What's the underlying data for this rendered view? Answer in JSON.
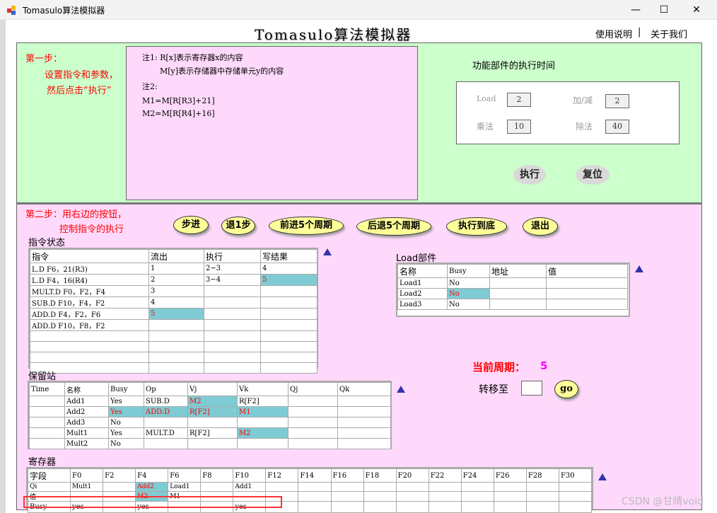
{
  "window": {
    "title": "Tomasulo算法模拟器",
    "controls": [
      "minimize",
      "maximize",
      "close"
    ]
  },
  "header": {
    "title": "Tomasulo算法模拟器",
    "links": [
      "使用说明",
      "关于我们"
    ],
    "separator": "|"
  },
  "step1": {
    "label": "第一步：",
    "line1": "设置指令和参数，",
    "line2": "然后点击“执行”"
  },
  "notes": {
    "n1": "注1: R[x]表示寄存器x的内容",
    "n1b": "M[y]表示存储器中存储单元y的内容",
    "n2": "注2:",
    "m1": "M1=M[R[R3]+21]",
    "m2": "M2=M[R[R4]+16]"
  },
  "exec_time": {
    "title": "功能部件的执行时间",
    "load_label": "Load",
    "load": "2",
    "add_label": "加/减",
    "add": "2",
    "mul_label": "乘法",
    "mul": "10",
    "div_label": "除法",
    "div": "40",
    "run": "执行",
    "reset": "复位"
  },
  "step2": {
    "line1": "第二步：用右边的按钮，",
    "line2": "控制指令的执行",
    "buttons": [
      "步进",
      "退1步",
      "前进5个周期",
      "后退5个周期",
      "执行到底",
      "退出"
    ]
  },
  "instr": {
    "title": "指令状态",
    "headers": [
      "指令",
      "流出",
      "执行",
      "写结果"
    ],
    "rows": [
      [
        "L.D    F6，21(R3)",
        "1",
        "2~3",
        "4"
      ],
      [
        "L.D    F4，16(R4)",
        "2",
        "3~4",
        "5"
      ],
      [
        "MULT.D F0，F2，F4",
        "3",
        "",
        ""
      ],
      [
        "SUB.D  F10，F4，F2",
        "4",
        "",
        ""
      ],
      [
        "ADD.D  F4，F2，F6",
        "5",
        "",
        ""
      ],
      [
        "ADD.D  F10，F8，F2",
        "",
        "",
        ""
      ]
    ]
  },
  "load": {
    "title": "Load部件",
    "headers": [
      "名称",
      "Busy",
      "地址",
      "值"
    ],
    "rows": [
      [
        "Load1",
        "No",
        "",
        ""
      ],
      [
        "Load2",
        "No",
        "",
        ""
      ],
      [
        "Load3",
        "No",
        "",
        ""
      ]
    ]
  },
  "cycle": {
    "label": "当前周期：",
    "value": "5",
    "goto_label": "转移至",
    "goto_value": "",
    "go": "go"
  },
  "rs": {
    "title": "保留站",
    "headers": [
      "Time",
      "名称",
      "Busy",
      "Op",
      "Vj",
      "Vk",
      "Qj",
      "Qk"
    ],
    "rows": [
      [
        "",
        "Add1",
        "Yes",
        "SUB.D",
        "M2",
        "R[F2]",
        "",
        ""
      ],
      [
        "",
        "Add2",
        "Yes",
        "ADD.D",
        "R[F2]",
        "M1",
        "",
        ""
      ],
      [
        "",
        "Add3",
        "No",
        "",
        "",
        "",
        "",
        ""
      ],
      [
        "",
        "Mult1",
        "Yes",
        "MULT.D",
        "R[F2]",
        "M2",
        "",
        ""
      ],
      [
        "",
        "Mult2",
        "No",
        "",
        "",
        "",
        "",
        ""
      ]
    ]
  },
  "reg": {
    "title": "寄存器",
    "headers": [
      "字段",
      "F0",
      "F2",
      "F4",
      "F6",
      "F8",
      "F10",
      "F12",
      "F14",
      "F16",
      "F18",
      "F20",
      "F22",
      "F24",
      "F26",
      "F28",
      "F30"
    ],
    "rows": [
      [
        "Qi",
        "Mult1",
        "",
        "Add2",
        "Load1",
        "",
        "Add1",
        "",
        "",
        "",
        "",
        "",
        "",
        "",
        "",
        "",
        ""
      ],
      [
        "值",
        "",
        "",
        "M2",
        "M1",
        "",
        "",
        "",
        "",
        "",
        "",
        "",
        "",
        "",
        "",
        "",
        ""
      ],
      [
        "Busy",
        "yes",
        "",
        "yes",
        "",
        "",
        "yes",
        "",
        "",
        "",
        "",
        "",
        "",
        "",
        "",
        "",
        ""
      ]
    ]
  },
  "highlight_color": "#7fcbd3",
  "watermark": "CSDN @甘晴void"
}
